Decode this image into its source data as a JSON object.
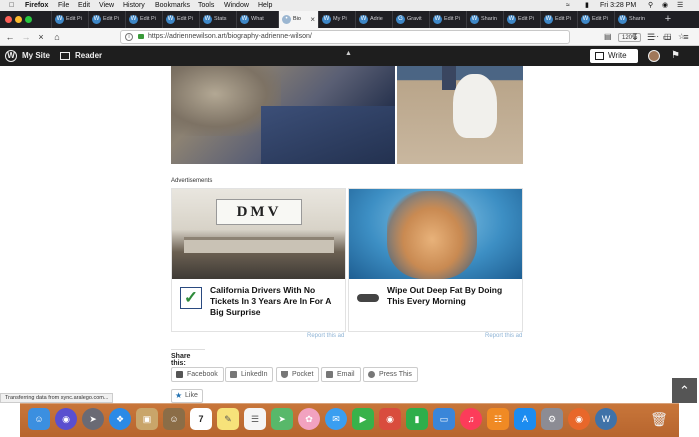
{
  "menubar": {
    "apple": "",
    "app": "Firefox",
    "menus": [
      "File",
      "Edit",
      "View",
      "History",
      "Bookmarks",
      "Tools",
      "Window",
      "Help"
    ],
    "clock": "Fri 3:28 PM"
  },
  "tabs": [
    {
      "label": "Edit Pi"
    },
    {
      "label": "Edit Pi"
    },
    {
      "label": "Edit Pi"
    },
    {
      "label": "Edit Pi"
    },
    {
      "label": "Stats"
    },
    {
      "label": "What"
    },
    {
      "label": "Bio",
      "active": true
    },
    {
      "label": "My Pi"
    },
    {
      "label": "Adrie"
    },
    {
      "label": "Gravit"
    },
    {
      "label": "Edit Pi"
    },
    {
      "label": "Sharin"
    },
    {
      "label": "Edit Pi"
    },
    {
      "label": "Edit Pi"
    },
    {
      "label": "Edit Pi"
    },
    {
      "label": "Sharin"
    }
  ],
  "navbar": {
    "url": "https://adriennewilson.art/biography-adrienne-wilson/",
    "zoom": "120%"
  },
  "wpbar": {
    "site": "My Site",
    "reader": "Reader",
    "write": "Write"
  },
  "content": {
    "ads_label": "Advertisements",
    "ad1": {
      "sign": "DMV",
      "title": "California Drivers With No Tickets In 3 Years Are In For A Big Surprise",
      "report": "Report this ad"
    },
    "ad2": {
      "title": "Wipe Out Deep Fat By Doing This Every Morning",
      "report": "Report this ad"
    },
    "share_title": "Share this:",
    "share_buttons": [
      "Facebook",
      "LinkedIn",
      "Pocket",
      "Email",
      "Press This"
    ],
    "like": "Like"
  },
  "status": "Transferring data from sync.aralego.com...",
  "dock": {
    "calendar_day": "7"
  }
}
